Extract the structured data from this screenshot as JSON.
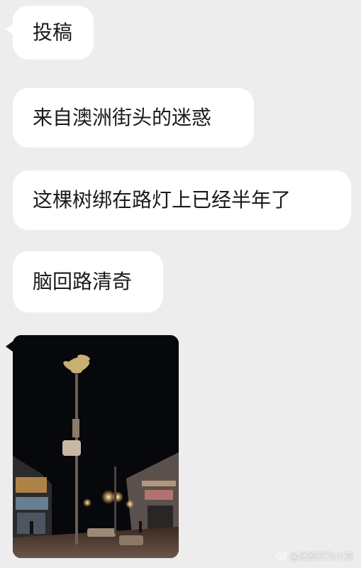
{
  "messages": [
    {
      "text": "投稿"
    },
    {
      "text": "来自澳洲街头的迷惑"
    },
    {
      "text": "这棵树绑在路灯上已经半年了"
    },
    {
      "text": "脑回路清奇"
    }
  ],
  "photo": {
    "description_icon": "street-night-photo"
  },
  "watermark": {
    "text": "@迷惑行为大赏"
  },
  "colors": {
    "background": "#ededed",
    "bubble": "#ffffff",
    "text": "#1a1a1a"
  }
}
